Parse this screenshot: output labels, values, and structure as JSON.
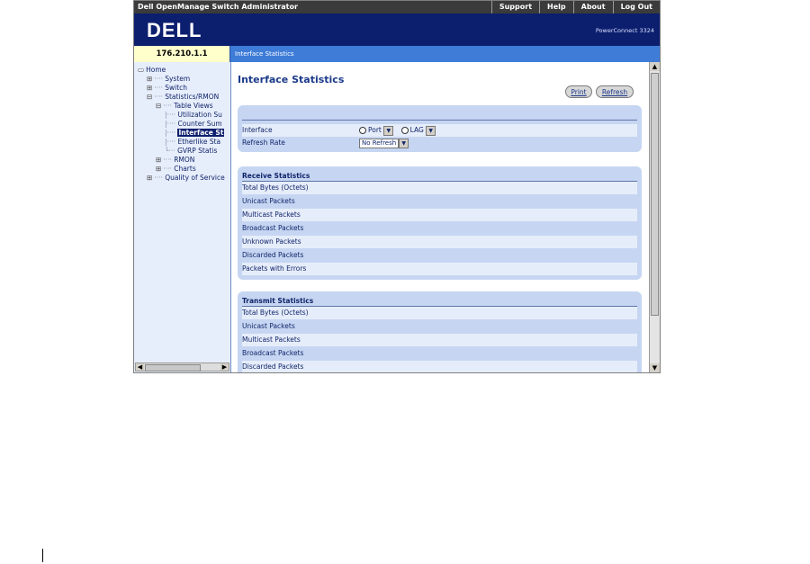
{
  "topbar": {
    "title": "Dell OpenManage Switch Administrator",
    "links": [
      "Support",
      "Help",
      "About",
      "Log Out"
    ]
  },
  "header": {
    "logo": "DELL",
    "product": "PowerConnect 3324"
  },
  "addressbar": {
    "ip": "176.210.1.1",
    "breadcrumb": "Interface Statistics"
  },
  "sidebar": {
    "items": [
      {
        "label": "Home",
        "glyph": "▭",
        "indent": 0
      },
      {
        "label": "System",
        "glyph": "⊞",
        "indent": 1
      },
      {
        "label": "Switch",
        "glyph": "⊞",
        "indent": 1
      },
      {
        "label": "Statistics/RMON",
        "glyph": "⊟",
        "indent": 1
      },
      {
        "label": "Table Views",
        "glyph": "⊟",
        "indent": 2
      },
      {
        "label": "Utilization Su",
        "glyph": "",
        "indent": 3
      },
      {
        "label": "Counter Sum",
        "glyph": "",
        "indent": 3
      },
      {
        "label": "Interface St",
        "glyph": "",
        "indent": 3,
        "selected": true
      },
      {
        "label": "Etherlike Sta",
        "glyph": "",
        "indent": 3
      },
      {
        "label": "GVRP Statis",
        "glyph": "",
        "indent": 3
      },
      {
        "label": "RMON",
        "glyph": "⊞",
        "indent": 2
      },
      {
        "label": "Charts",
        "glyph": "⊞",
        "indent": 2
      },
      {
        "label": "Quality of Service",
        "glyph": "⊞",
        "indent": 1
      }
    ]
  },
  "main": {
    "title": "Interface Statistics",
    "buttons": {
      "print": "Print",
      "refresh": "Refresh"
    },
    "settings": {
      "interface_label": "Interface",
      "port_label": "Port",
      "lag_label": "LAG",
      "refresh_label": "Refresh Rate",
      "refresh_value": "No Refresh"
    },
    "receive": {
      "heading": "Receive Statistics",
      "rows": [
        "Total Bytes (Octets)",
        "Unicast Packets",
        "Multicast Packets",
        "Broadcast Packets",
        "Unknown Packets",
        "Discarded Packets",
        "Packets with Errors"
      ]
    },
    "transmit": {
      "heading": "Transmit Statistics",
      "rows": [
        "Total Bytes (Octets)",
        "Unicast Packets",
        "Multicast Packets",
        "Broadcast Packets",
        "Discarded Packets"
      ]
    }
  },
  "colors": {
    "header": "#0c1e6e",
    "addressbar": "#3e7cd8",
    "ip_bg": "#ffffcc",
    "panel": "#c6d6f2"
  }
}
